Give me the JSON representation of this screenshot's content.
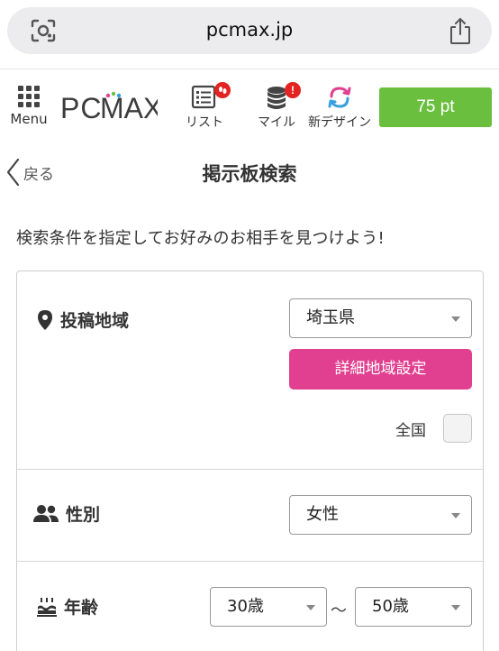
{
  "browser": {
    "domain": "pcmax.jp",
    "lens_icon": "visual-search-icon",
    "share_icon": "share-icon"
  },
  "header": {
    "menu_label": "Menu",
    "logo_text": "PCMAX",
    "nav": [
      {
        "label": "リスト",
        "icon": "list-icon",
        "badge": "footprint"
      },
      {
        "label": "マイル",
        "icon": "coins-icon",
        "badge": "!"
      },
      {
        "label": "新デザイン",
        "icon": "refresh-icon"
      }
    ],
    "points_label": "75 pt",
    "colors": {
      "points_bg": "#6bbf3e",
      "badge": "#e32222",
      "logo_accent": "#e0408f"
    }
  },
  "title_bar": {
    "back_label": "戻る",
    "page_title": "掲示板検索"
  },
  "intro_text": "検索条件を指定してお好みのお相手を見つけよう!",
  "form": {
    "region": {
      "label": "投稿地域",
      "icon": "map-pin-icon",
      "selected": "埼玉県",
      "detail_button": "詳細地域設定",
      "nationwide_label": "全国",
      "nationwide_checked": false
    },
    "gender": {
      "label": "性別",
      "icon": "users-icon",
      "selected": "女性"
    },
    "age": {
      "label": "年齢",
      "icon": "birthday-cake-icon",
      "min": "30歳",
      "separator": "〜",
      "max": "50歳"
    },
    "colors": {
      "primary_button": "#e0408f"
    }
  }
}
